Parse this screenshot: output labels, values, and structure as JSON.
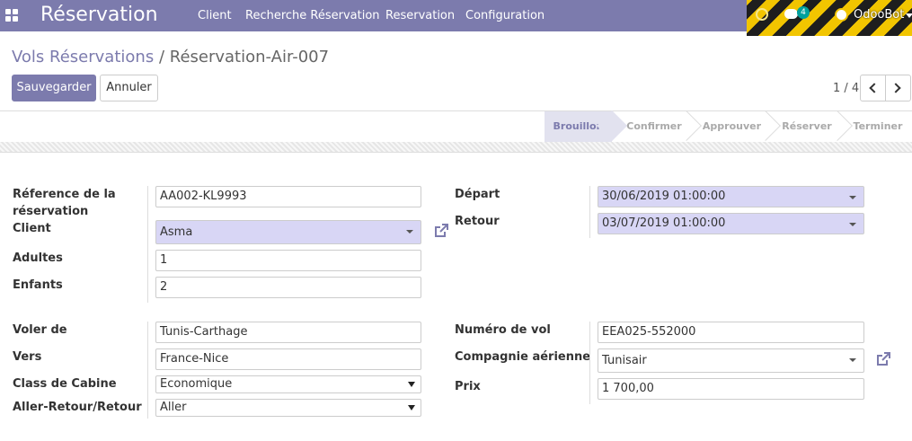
{
  "navbar": {
    "brand": "Réservation",
    "menu": [
      "Client",
      "Recherche Réservation",
      "Reservation",
      "Configuration"
    ],
    "badge_count": "4",
    "user_name": "OdooBot"
  },
  "breadcrumb": {
    "parent": "Vols Réservations",
    "separator": "/",
    "current": "Réservation-Air-007"
  },
  "buttons": {
    "save": "Sauvegarder",
    "discard": "Annuler"
  },
  "pager": {
    "value": "1 / 4"
  },
  "statusbar": {
    "stages": [
      "Brouillon",
      "Confirmer",
      "Approuver",
      "Réserver",
      "Terminer"
    ],
    "active": "Brouillon"
  },
  "form": {
    "group1_left": {
      "reference_label": "Réference de la réservation",
      "reference_label_line1": "Réference de la",
      "reference_label_line2": "réservation",
      "reference_value": "AA002-KL9993",
      "client_label": "Client",
      "client_value": "Asma",
      "adults_label": "Adultes",
      "adults_value": "1",
      "children_label": "Enfants",
      "children_value": "2"
    },
    "group1_right": {
      "departure_label": "Départ",
      "departure_value": "30/06/2019 01:00:00",
      "return_label": "Retour",
      "return_value": "03/07/2019 01:00:00"
    },
    "group2_left": {
      "from_label": "Voler de",
      "from_value": "Tunis-Carthage",
      "to_label": "Vers",
      "to_value": "France-Nice",
      "cabin_label": "Class de Cabine",
      "cabin_value": "Economique",
      "trip_label": "Aller-Retour/Retour",
      "trip_value": "Aller"
    },
    "group2_right": {
      "flight_label": "Numéro de vol",
      "flight_value": "EEA025-552000",
      "airline_label": "Compagnie aérienne",
      "airline_value": "Tunisair",
      "price_label": "Prix",
      "price_value": "1 700,00"
    }
  },
  "icons": {
    "apps": "apps-grid-icon",
    "clock": "clock-icon",
    "chat": "chat-bubbles-icon",
    "external": "external-link-icon"
  },
  "colors": {
    "brand": "#7c7bad",
    "required_field": "#d8d6f5",
    "active_stage": "#e2e2ef",
    "badge": "#00a09d"
  }
}
